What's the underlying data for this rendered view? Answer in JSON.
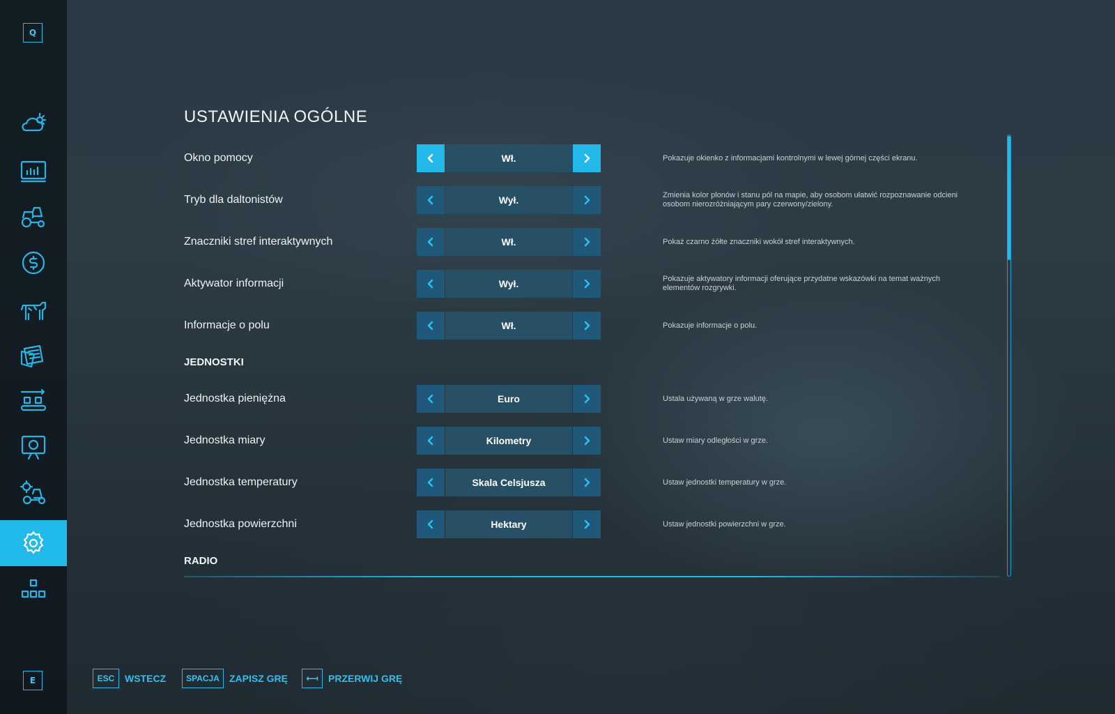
{
  "sidebar": {
    "top_key": "Q",
    "bottom_key": "E",
    "items": [
      {
        "id": "weather"
      },
      {
        "id": "statistics"
      },
      {
        "id": "vehicles"
      },
      {
        "id": "finances"
      },
      {
        "id": "animals"
      },
      {
        "id": "contracts"
      },
      {
        "id": "production"
      },
      {
        "id": "tutorials"
      },
      {
        "id": "vehicle-settings"
      },
      {
        "id": "settings",
        "active": true
      },
      {
        "id": "more"
      }
    ]
  },
  "main": {
    "title": "USTAWIENIA OGÓLNE",
    "rows": [
      {
        "label": "Okno pomocy",
        "value": "Wł.",
        "description": "Pokazuje okienko z informacjami kontrolnymi w lewej górnej części ekranu.",
        "focused": true
      },
      {
        "label": "Tryb dla daltonistów",
        "value": "Wył.",
        "description": "Zmienia kolor plonów i stanu pól na mapie, aby osobom ułatwić rozpoznawanie odcieni osobom nierozróżniającym pary czerwony/zielony."
      },
      {
        "label": "Znaczniki stref interaktywnych",
        "value": "Wł.",
        "description": "Pokaż czarno żółte znaczniki wokół stref interaktywnych."
      },
      {
        "label": "Aktywator informacji",
        "value": "Wył.",
        "description": "Pokazuje aktywatory informacji oferujące przydatne wskazówki na temat ważnych elementów rozgrywki."
      },
      {
        "label": "Informacje o polu",
        "value": "Wł.",
        "description": "Pokazuje informacje o polu."
      }
    ],
    "units_header": "JEDNOSTKI",
    "unit_rows": [
      {
        "label": "Jednostka pieniężna",
        "value": "Euro",
        "description": "Ustala używaną w grze walutę."
      },
      {
        "label": "Jednostka miary",
        "value": "Kilometry",
        "description": "Ustaw miary odległości w grze."
      },
      {
        "label": "Jednostka temperatury",
        "value": "Skala Celsjusza",
        "description": "Ustaw jednostki temperatury w grze."
      },
      {
        "label": "Jednostka powierzchni",
        "value": "Hektary",
        "description": "Ustaw jednostki powierzchni w grze."
      }
    ],
    "radio_header": "RADIO"
  },
  "footer": {
    "back": {
      "key": "ESC",
      "label": "WSTECZ"
    },
    "save": {
      "key": "SPACJA",
      "label": "ZAPISZ GRĘ"
    },
    "quit": {
      "key": "⟻",
      "label": "PRZERWIJ GRĘ"
    }
  },
  "colors": {
    "accent": "#22b8ea",
    "selector_value_bg": "#275067",
    "arrow_bg": "#1f5878"
  }
}
